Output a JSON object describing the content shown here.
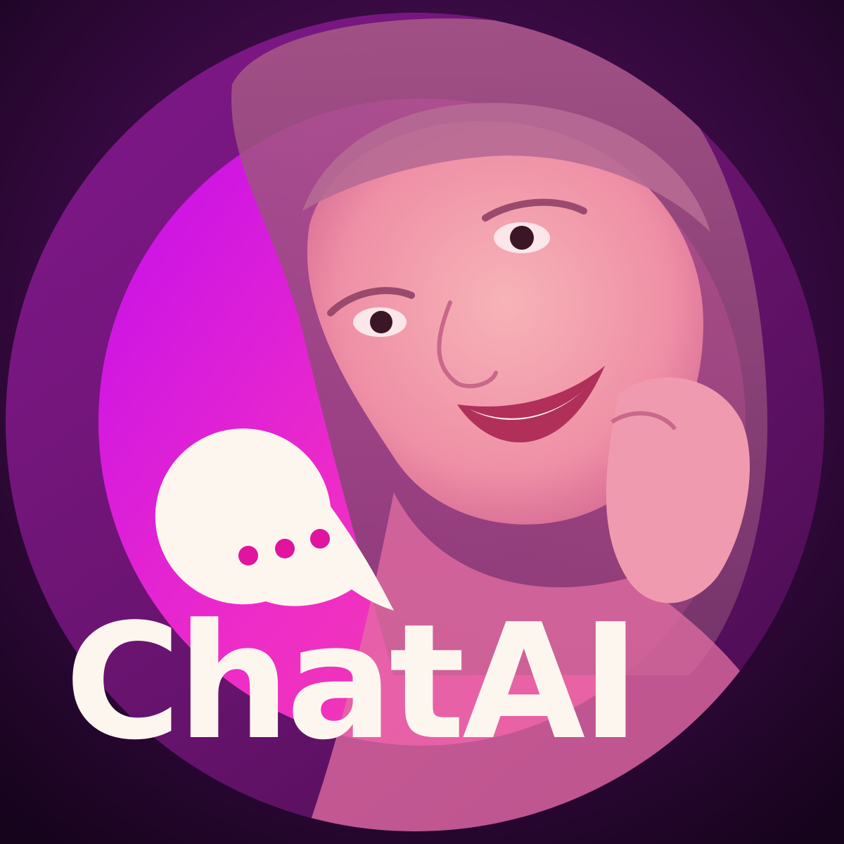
{
  "banner": {
    "logo": {
      "icon": "speech-bubble-dots-icon",
      "word_part1": "Chat",
      "word_part2": "AI"
    }
  },
  "colors": {
    "background": "#1e0526",
    "outer_circle": "#6a1470",
    "inner_circle": "#e81fd6",
    "logo": "#fdf6ee",
    "dots": "#e0149f"
  }
}
